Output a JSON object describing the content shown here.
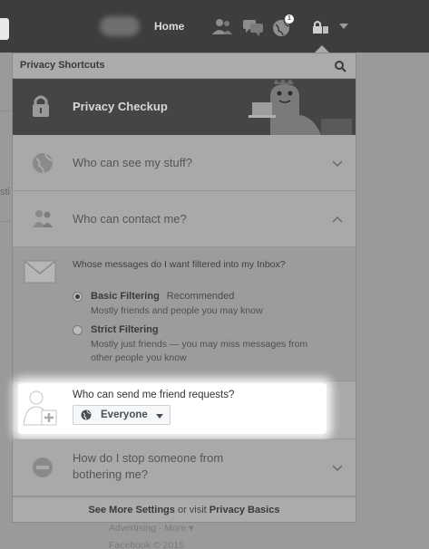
{
  "topbar": {
    "home_label": "Home",
    "notification_count": "1",
    "icons": [
      "friends-icon",
      "messages-icon",
      "globe-notifications-icon",
      "privacy-shortcuts-icon",
      "account-menu-caret-icon"
    ]
  },
  "background": {
    "left_stub_text": "sti",
    "below_panel_line1": "Advertising · More ▾",
    "below_panel_line2": "Facebook © 2015"
  },
  "panel": {
    "title": "Privacy Shortcuts",
    "checkup_label": "Privacy Checkup",
    "rows": [
      {
        "label": "Who can see my stuff?",
        "icon": "globe-icon",
        "state": "collapsed"
      },
      {
        "label": "Who can contact me?",
        "icon": "people-icon",
        "state": "expanded"
      },
      {
        "label": "How do I stop someone from bothering me?",
        "icon": "block-icon",
        "state": "collapsed"
      }
    ],
    "contact": {
      "question": "Whose messages do I want filtered into my Inbox?",
      "options": [
        {
          "title": "Basic Filtering",
          "tag": "Recommended",
          "desc": "Mostly friends and people you may know",
          "selected": true
        },
        {
          "title": "Strict Filtering",
          "tag": "",
          "desc": "Mostly just friends — you may miss messages from other people you know",
          "selected": false
        }
      ],
      "friend_requests_question": "Who can send me friend requests?",
      "friend_requests_value": "Everyone"
    },
    "footer": {
      "link1": "See More Settings",
      "middle": " or visit ",
      "link2": "Privacy Basics"
    }
  },
  "colors": {
    "overlay_gray": "#a9a9a9",
    "dark_bar": "#3d3d3d",
    "highlight": "#ffffff"
  }
}
